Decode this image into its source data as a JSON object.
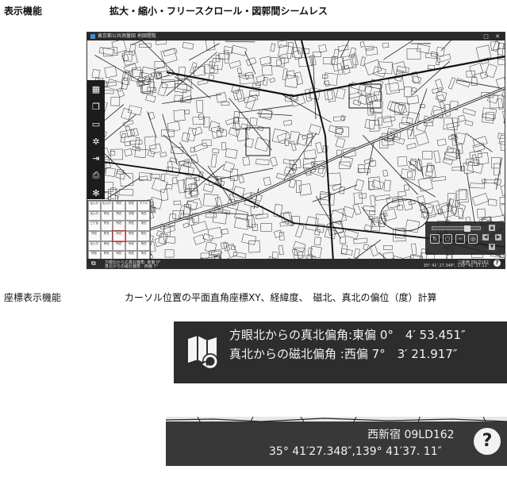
{
  "sections": {
    "display": {
      "heading": "表示機能",
      "caption": "拡大・縮小・フリースクロール・図郭間シームレス"
    },
    "coords": {
      "heading": "座標表示機能",
      "caption": "カーソル位置の平面直角座標XY、経緯度、　磁北、真北の偏位（度）計算"
    }
  },
  "app": {
    "title": "東京都公共測量図 地図閲覧",
    "window_controls": "□ ✕",
    "sidebar_icons": [
      "grid-icon",
      "layers-icon",
      "comment-icon",
      "settings-gear-icon",
      "export-icon",
      "print-icon",
      "tools-icon"
    ],
    "sheet_grid_cells": [
      "出入口",
      "出入口",
      "所在",
      "所在",
      "ホテル",
      "出入口",
      "所在",
      "所在",
      "学校",
      "所在",
      "三丁目",
      "所在",
      "所在",
      "所在",
      "所在",
      "所在",
      "所在",
      "所在",
      "所在",
      "所在",
      "出入口",
      "所在",
      "所在",
      "所在",
      "所在",
      "所在",
      "所在",
      "所在",
      "所在",
      "所在"
    ],
    "selected_cell": 17,
    "statusbar": {
      "line1": "方眼北からの真北偏角: 東偏 0°",
      "line2": "真北からの磁北偏角 : 西偏 7°",
      "right1": "三新宿 09LD162",
      "right2": "35° 41' 27.348\", 139° 41' 37.11\""
    },
    "help_label": "?"
  },
  "zoom_declination": {
    "line1": "方眼北からの真北偏角:東偏 0°　4′ 53.451″",
    "line2": "真北からの磁北偏角 :西偏 7°　3′ 21.917″"
  },
  "zoom_position": {
    "sheet": "西新宿 09LD162",
    "coords": "35° 41′27.348″,139° 41′37. 11″",
    "help_label": "?"
  }
}
